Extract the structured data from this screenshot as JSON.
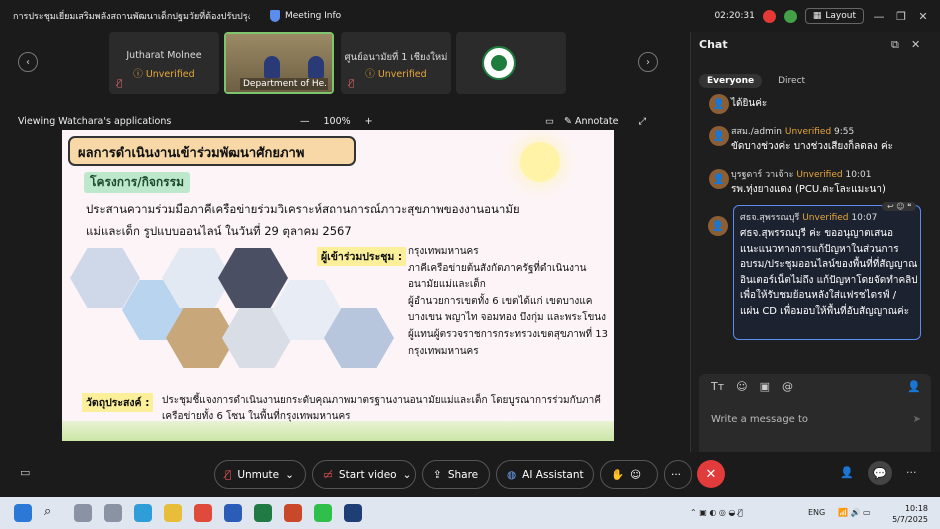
{
  "titlebar": {
    "meeting_title": "การประชุมเยี่ยมเสริมพลังสถานพัฒนาเด็กปฐมวัยที่ต้องปรับปรุงตั...",
    "app_label": "Meeting Info",
    "timer": "02:20:31",
    "layout_label": "Layout"
  },
  "participants": [
    {
      "name": "Jutharat Molnee",
      "status": "Unverified"
    },
    {
      "name": "Department of He..."
    },
    {
      "name": "ศูนย์อนามัยที่ 1 เชียงใหม่",
      "status": "Unverified"
    },
    {
      "name": ""
    }
  ],
  "view": {
    "viewing_label": "Viewing Watchara's applications",
    "zoom": "100%",
    "zoom_minus": "—",
    "zoom_plus": "+",
    "annotate_label": "Annotate"
  },
  "slide": {
    "title": "ผลการดำเนินงานเข้าร่วมพัฒนาศักยภาพ",
    "project_label": "โครงการ/กิจกรรม",
    "project_line1": "ประสานความร่วมมือภาคีเครือข่ายร่วมวิเคราะห์สถานการณ์ภาวะสุขภาพของงานอนามัย",
    "project_line2": "แม่และเด็ก รูปแบบออนไลน์ ในวันที่ 29 ตุลาคม 2567",
    "attendees_label": "ผู้เข้าร่วมประชุม :",
    "attendees": [
      "กรุงเทพมหานคร",
      "ภาคีเครือข่ายต้นสังกัดภาครัฐที่ดำเนินงาน",
      "อนามัยแม่และเด็ก",
      "ผู้อำนวยการเขตทั้ง 6 เขตได้แก่ เขตบางแค",
      "บางเขน พญาไท จอมทอง บึงกุ่ม และพระโขนง",
      "ผู้แทนผู้ตรวจราชการกระทรวงเขตสุขภาพที่ 13",
      "กรุงเทพมหานคร"
    ],
    "objective_label": "วัตถุประสงค์ :",
    "objective_line1": "ประชุมชี้แจงการดำเนินงานยกระดับคุณภาพมาตรฐานงานอนามัยแม่และเด็ก โดยบูรณาการร่วมกับภาคี",
    "objective_line2": "เครือข่ายทั้ง 6 โซน ในพื้นที่กรุงเทพมหานคร"
  },
  "chat": {
    "title": "Chat",
    "tab_everyone": "Everyone",
    "tab_direct": "Direct",
    "messages": [
      {
        "text": "ได้ยินค่ะ"
      },
      {
        "sender": "สสม./admin",
        "status": "Unverified",
        "time": "9:55",
        "text": "ขัดบางช่วงค่ะ บางช่วงเสียงก็ลดลง ค่ะ"
      },
      {
        "sender": "บุรฐดาร์ วาเจ้าะ",
        "status": "Unverified",
        "time": "10:01",
        "text": "รพ.ทุ่งยางแดง (PCU.ตะโละแมะนา)"
      },
      {
        "sender": "ศธจ.สุพรรณบุรี",
        "status": "Unverified",
        "time": "10:07",
        "text": "ศธจ.สุพรรณบุรี ค่ะ ขออนุญาตเสนอแนะแนวทางการแก้ปัญหาในส่วนการอบรม/ประชุมออนไลน์ของพื้นที่ที่สัญญาณอินเตอร์เน็ตไม่ถึง แก้ปัญหาโดยจัดทำคลิปเพื่อให้รับชมย้อนหลังใส่แฟรชไดรฟ์ / แผ่น CD เพื่อมอบให้พื้นที่อับสัญญาณค่ะ"
      }
    ],
    "placeholder": "Write a message to"
  },
  "controls": {
    "unmute": "Unmute",
    "start_video": "Start video",
    "share": "Share",
    "ai_assistant": "AI Assistant",
    "more": "···",
    "end": "✕"
  },
  "taskbar": {
    "lang": "ENG",
    "time": "10:18",
    "date": "5/7/2025"
  },
  "colors": {
    "unverified": "#e7a73a",
    "end_red": "#e23b3b",
    "chat_highlight": "#5b8def"
  }
}
